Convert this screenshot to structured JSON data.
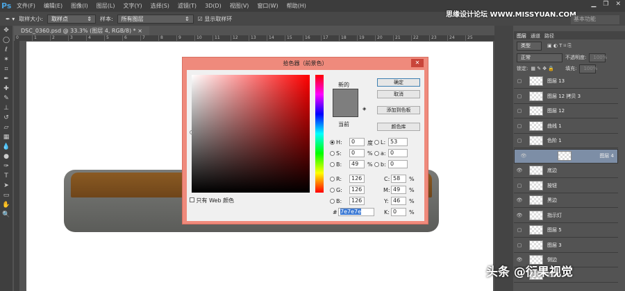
{
  "menubar": {
    "logo": "Ps",
    "items": [
      "文件(F)",
      "编辑(E)",
      "图像(I)",
      "图层(L)",
      "文字(Y)",
      "选择(S)",
      "滤镜(T)",
      "3D(D)",
      "视图(V)",
      "窗口(W)",
      "帮助(H)"
    ]
  },
  "options": {
    "sample_size_label": "取样大小:",
    "sample_size": "取样点",
    "sample_label": "样本:",
    "sample": "所有图层",
    "show_ring": "显示取样环"
  },
  "watermark": "思缘设计论坛 WWW.MISSYUAN.COM",
  "workspace": "基本功能",
  "doc_tab": "DSC_0360.psd @ 33.3% (图层 4, RGB/8) *",
  "ruler": [
    "0",
    "1",
    "2",
    "3",
    "4",
    "5",
    "6",
    "7",
    "8",
    "9",
    "10",
    "11",
    "12",
    "13",
    "14",
    "15",
    "16",
    "17",
    "18",
    "19",
    "20",
    "21",
    "22",
    "23",
    "24",
    "25"
  ],
  "dialog": {
    "title": "拾色器（前景色）",
    "new": "新的",
    "current": "当前",
    "ok": "确定",
    "cancel": "取消",
    "add_swatch": "添加到色板",
    "libraries": "颜色库",
    "web_only": "只有 Web 颜色",
    "fields": {
      "H": "0",
      "S": "0",
      "B": "49",
      "R": "126",
      "G": "126",
      "Bl": "126",
      "L": "53",
      "a": "0",
      "b": "0",
      "C": "58",
      "M": "49",
      "Y": "46",
      "K": "0"
    },
    "units": {
      "deg": "度",
      "pct": "%"
    },
    "hex": "7e7e7e",
    "color": "#7e7e7e"
  },
  "panel": {
    "tabs": [
      "图层",
      "通道",
      "路径"
    ],
    "filter": "类型",
    "blend": "正常",
    "opacity_label": "不透明度:",
    "opacity": "100%",
    "lock_label": "锁定:",
    "fill_label": "填充:",
    "fill": "100%",
    "layers": [
      {
        "name": "图层 13",
        "visible": false
      },
      {
        "name": "图层 12 拷贝 3",
        "visible": false
      },
      {
        "name": "图层 12",
        "visible": false
      },
      {
        "name": "曲线 1",
        "visible": false
      },
      {
        "name": "色阶 1",
        "visible": false
      },
      {
        "name": "图层 4",
        "visible": true,
        "selected": true
      },
      {
        "name": "底边",
        "visible": true
      },
      {
        "name": "按钮",
        "visible": false
      },
      {
        "name": "黑边",
        "visible": true
      },
      {
        "name": "指示灯",
        "visible": true
      },
      {
        "name": "图层 5",
        "visible": false
      },
      {
        "name": "图层 3",
        "visible": false
      },
      {
        "name": "侧边",
        "visible": true
      },
      {
        "name": "图层 1",
        "visible": false
      }
    ]
  },
  "credit": "头条 @衍果视觉"
}
